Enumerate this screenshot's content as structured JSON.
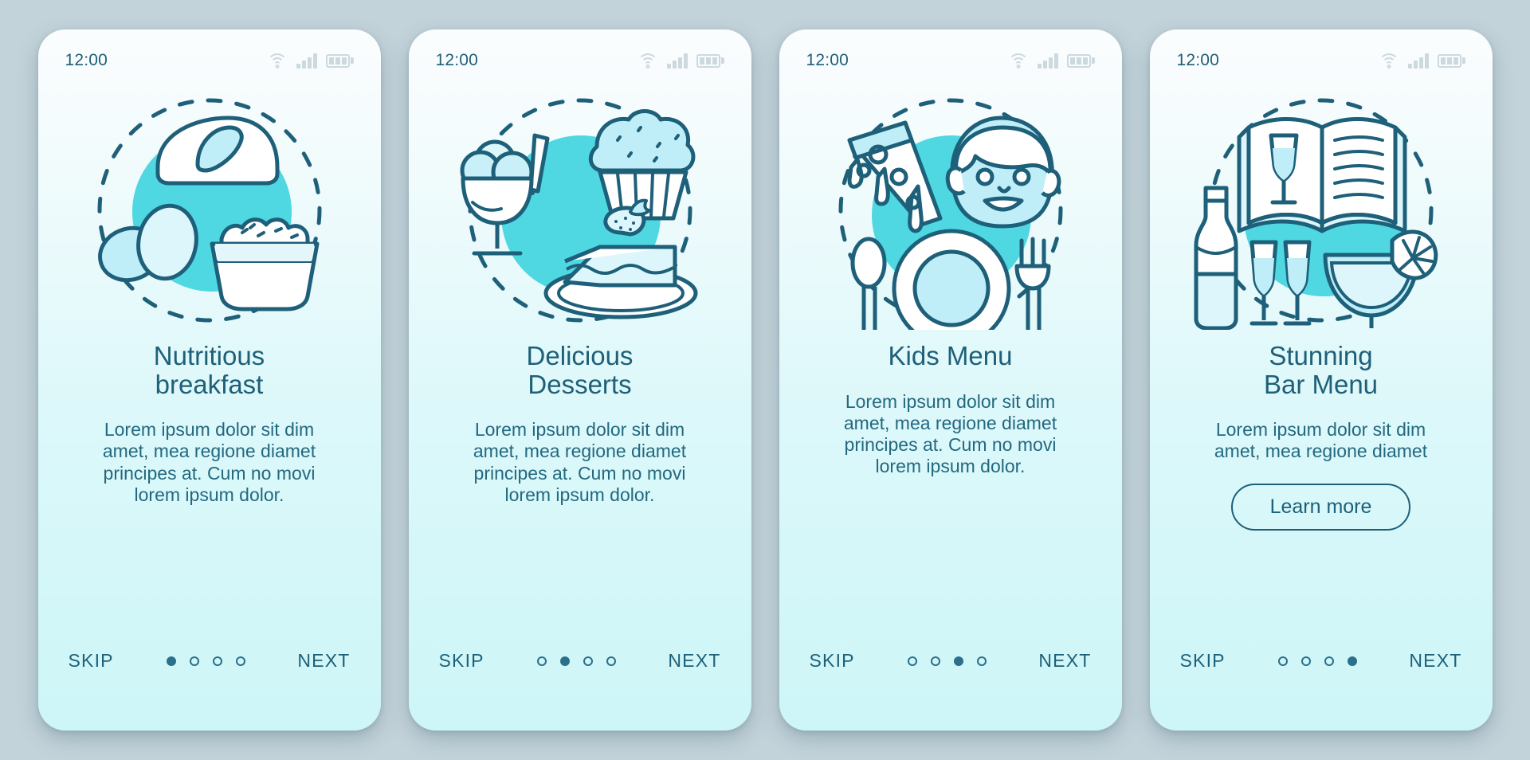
{
  "theme": {
    "page_background": "#c3d3da",
    "card_background_top": "#fbfdfe",
    "card_background_bottom": "#cdf6f8",
    "accent_circle": "#4fd8e2",
    "line_color": "#1e6079",
    "title_color": "#1e6079",
    "body_color": "#23687f",
    "status_icon_color": "#ccd9de"
  },
  "status_bar": {
    "time": "12:00",
    "icons": [
      "wifi-icon",
      "signal-icon",
      "battery-icon"
    ],
    "signal_bars": 4,
    "battery_segments": 3
  },
  "screens": [
    {
      "id": "nutritious-breakfast",
      "illustration": "breakfast-illustration",
      "title": "Nutritious\nbreakfast",
      "body": "Lorem ipsum dolor sit dim\namet, mea regione diamet\nprincipes at. Cum no movi\nlorem ipsum dolor.",
      "has_button": false,
      "button_label": "",
      "nav": {
        "skip_label": "SKIP",
        "next_label": "NEXT",
        "dots": 4,
        "active_dot": 1
      }
    },
    {
      "id": "delicious-desserts",
      "illustration": "desserts-illustration",
      "title": "Delicious\nDesserts",
      "body": "Lorem ipsum dolor sit dim\namet, mea regione diamet\nprincipes at. Cum no movi\nlorem ipsum dolor.",
      "has_button": false,
      "button_label": "",
      "nav": {
        "skip_label": "SKIP",
        "next_label": "NEXT",
        "dots": 4,
        "active_dot": 2
      }
    },
    {
      "id": "kids-menu",
      "illustration": "kids-menu-illustration",
      "title": "Kids Menu",
      "body": "Lorem ipsum dolor sit dim\namet, mea regione diamet\nprincipes at. Cum no movi\nlorem ipsum dolor.",
      "has_button": false,
      "button_label": "",
      "nav": {
        "skip_label": "SKIP",
        "next_label": "NEXT",
        "dots": 4,
        "active_dot": 3
      }
    },
    {
      "id": "stunning-bar-menu",
      "illustration": "bar-menu-illustration",
      "title": "Stunning\nBar Menu",
      "body": "Lorem ipsum dolor sit dim\namet, mea regione diamet",
      "has_button": true,
      "button_label": "Learn more",
      "nav": {
        "skip_label": "SKIP",
        "next_label": "NEXT",
        "dots": 4,
        "active_dot": 4
      }
    }
  ]
}
